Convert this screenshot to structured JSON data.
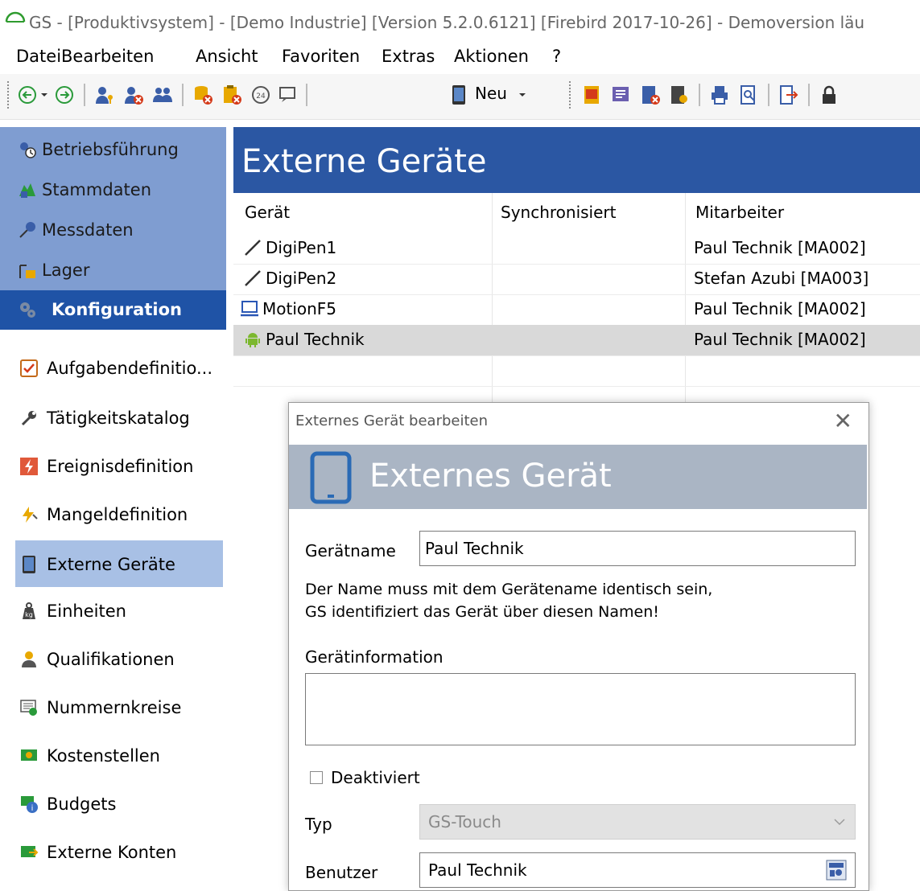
{
  "window": {
    "title": "GS - [Produktivsystem] - [Demo Industrie]  [Version  5.2.0.6121]  [Firebird 2017-10-26] - Demoversion läu"
  },
  "menu": [
    "Datei",
    "Bearbeiten",
    "Ansicht",
    "Favoriten",
    "Extras",
    "Aktionen",
    "?"
  ],
  "toolbar": {
    "new_label": "Neu"
  },
  "nav": {
    "top_items": [
      "Betriebsführung",
      "Stammdaten",
      "Messdaten",
      "Lager"
    ],
    "active_item": "Konfiguration",
    "sub_items": [
      "Aufgabendefinitio...",
      "Tätigkeitskatalog",
      "Ereignisdefinition",
      "Mangeldefinition",
      "Externe Geräte",
      "Einheiten",
      "Qualifikationen",
      "Nummernkreise",
      "Kostenstellen",
      "Budgets",
      "Externe Konten"
    ],
    "selected_sub": "Externe Geräte"
  },
  "content": {
    "title": "Externe Geräte",
    "columns": [
      "Gerät",
      "Synchronisiert",
      "Mitarbeiter"
    ],
    "rows": [
      {
        "device": "DigiPen1",
        "icon": "pen-icon",
        "synced": "",
        "employee": "Paul Technik [MA002]"
      },
      {
        "device": "DigiPen2",
        "icon": "pen-icon",
        "synced": "",
        "employee": "Stefan Azubi [MA003]"
      },
      {
        "device": "MotionF5",
        "icon": "laptop-icon",
        "synced": "",
        "employee": "Paul Technik [MA002]"
      },
      {
        "device": "Paul Technik",
        "icon": "android-icon",
        "synced": "",
        "employee": "Paul Technik [MA002]"
      }
    ]
  },
  "dialog": {
    "window_title": "Externes Gerät bearbeiten",
    "banner_title": "Externes Gerät",
    "device_name_label": "Gerätname",
    "device_name_value": "Paul Technik",
    "hint_line1": "Der Name muss mit dem Gerätename identisch sein,",
    "hint_line2": "GS identifiziert das Gerät über diesen Namen!",
    "info_label": "Gerätinformation",
    "info_value": "",
    "deactivated_label": "Deaktiviert",
    "deactivated_checked": false,
    "type_label": "Typ",
    "type_value": "GS-Touch",
    "user_label": "Benutzer",
    "user_value": "Paul Technik"
  }
}
